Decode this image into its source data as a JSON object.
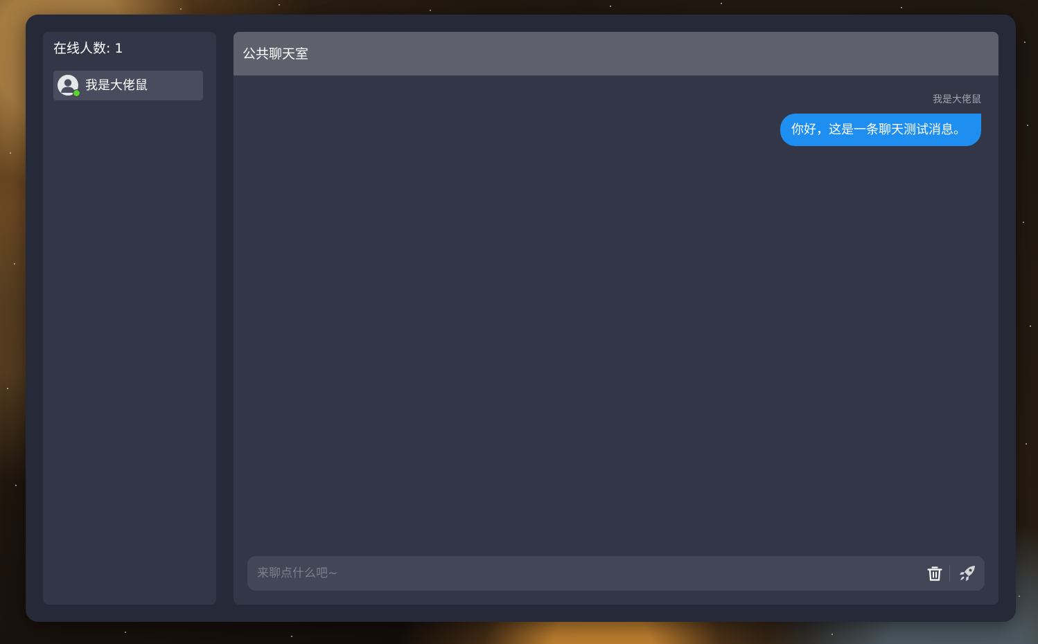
{
  "sidebar": {
    "online_label": "在线人数: 1",
    "users": [
      {
        "name": "我是大佬鼠",
        "status": "online",
        "avatar_icon": "user-avatar-icon"
      }
    ]
  },
  "chat": {
    "title": "公共聊天室",
    "messages": [
      {
        "sender": "我是大佬鼠",
        "text": "你好，这是一条聊天测试消息。",
        "side": "right"
      }
    ],
    "input": {
      "value": "",
      "placeholder": "来聊点什么吧~"
    },
    "actions": {
      "clear_icon": "trash-icon",
      "send_icon": "rocket-icon"
    }
  },
  "colors": {
    "accent": "#1f8ef1",
    "online": "#5cd62e",
    "panel": "#323646",
    "frame": "#262a38",
    "header": "#5e606c"
  }
}
